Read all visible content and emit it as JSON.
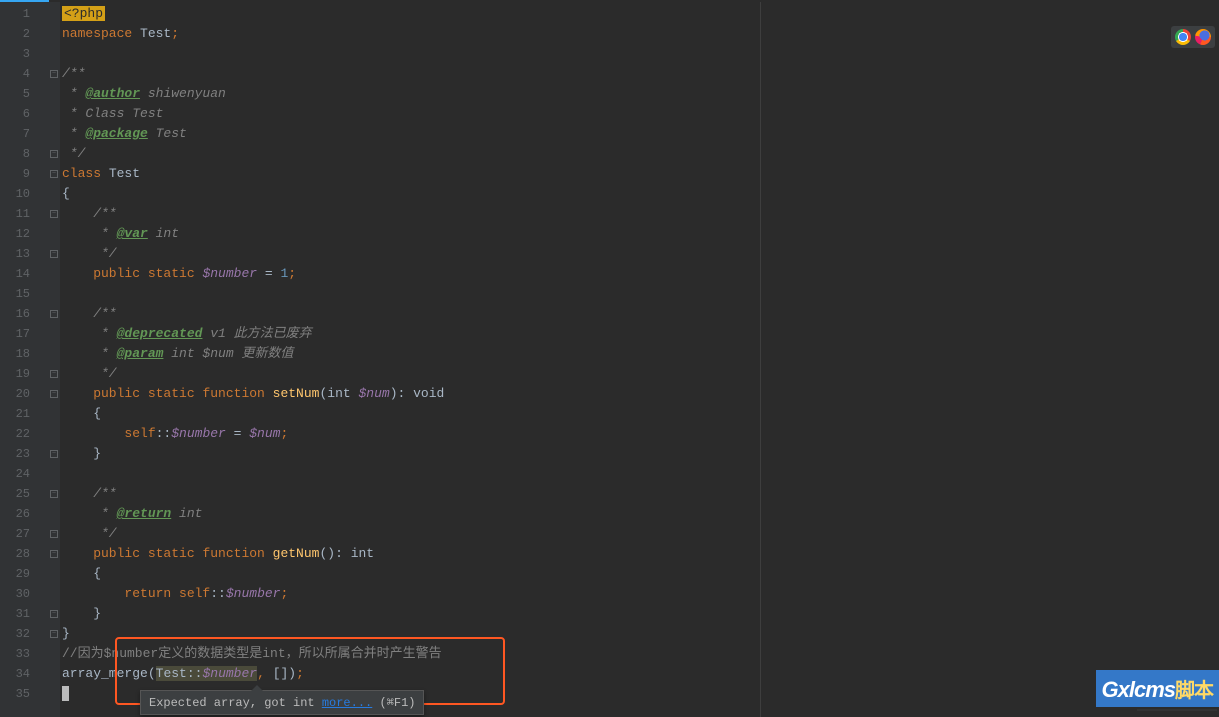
{
  "gutter_lines": [
    "1",
    "2",
    "3",
    "4",
    "5",
    "6",
    "7",
    "8",
    "9",
    "10",
    "11",
    "12",
    "13",
    "14",
    "15",
    "16",
    "17",
    "18",
    "19",
    "20",
    "21",
    "22",
    "23",
    "24",
    "25",
    "26",
    "27",
    "28",
    "29",
    "30",
    "31",
    "32",
    "33",
    "34",
    "35"
  ],
  "code": {
    "l1_php": "<?php",
    "l2_kw": "namespace",
    "l2_ns": " Test",
    "l2_semi": ";",
    "l4": "/**",
    "l5_pre": " * ",
    "l5_tag": "@author",
    "l5_post": " shiwenyuan",
    "l6": " * Class Test",
    "l7_pre": " * ",
    "l7_tag": "@package",
    "l7_post": " Test",
    "l8": " */",
    "l9_kw": "class ",
    "l9_name": "Test",
    "l10": "{",
    "l11": "    /**",
    "l12_pre": "     * ",
    "l12_tag": "@var",
    "l12_post": " int",
    "l13": "     */",
    "l14_pub": "    public ",
    "l14_stat": "static ",
    "l14_var": "$number",
    "l14_eq": " = ",
    "l14_val": "1",
    "l14_semi": ";",
    "l16": "    /**",
    "l17_pre": "     * ",
    "l17_tag": "@deprecated",
    "l17_post": " v1 此方法已废弃",
    "l18_pre": "     * ",
    "l18_tag": "@param",
    "l18_post": " int $num 更新数值",
    "l19": "     */",
    "l20_pub": "    public ",
    "l20_stat": "static ",
    "l20_func": "function ",
    "l20_name": "setNum",
    "l20_open": "(",
    "l20_type": "int ",
    "l20_param": "$num",
    "l20_close": "): ",
    "l20_ret": "void",
    "l21": "    {",
    "l22_self": "        self",
    "l22_dcolon": "::",
    "l22_var": "$number",
    "l22_eq": " = ",
    "l22_rhs": "$num",
    "l22_semi": ";",
    "l23": "    }",
    "l25": "    /**",
    "l26_pre": "     * ",
    "l26_tag": "@return",
    "l26_post": " int",
    "l27": "     */",
    "l28_pub": "    public ",
    "l28_stat": "static ",
    "l28_func": "function ",
    "l28_name": "getNum",
    "l28_parens": "(): ",
    "l28_ret": "int",
    "l29": "    {",
    "l30_ret": "        return ",
    "l30_self": "self",
    "l30_dcolon": "::",
    "l30_var": "$number",
    "l30_semi": ";",
    "l31": "    }",
    "l32": "}",
    "l33": "//因为$number定义的数据类型是int，所以所属合并时产生警告",
    "l34_fn": "array_merge",
    "l34_open": "(",
    "l34_cls": "Test",
    "l34_dc": "::",
    "l34_var": "$number",
    "l34_comma": ",",
    "l34_arr": " []",
    "l34_close": ")",
    "l34_semi": ";"
  },
  "tooltip": {
    "text": "Expected array, got int ",
    "more": "more...",
    "shortcut": " (⌘F1)"
  },
  "watermark": {
    "en": "Gxlcms",
    "cn": "脚本"
  }
}
